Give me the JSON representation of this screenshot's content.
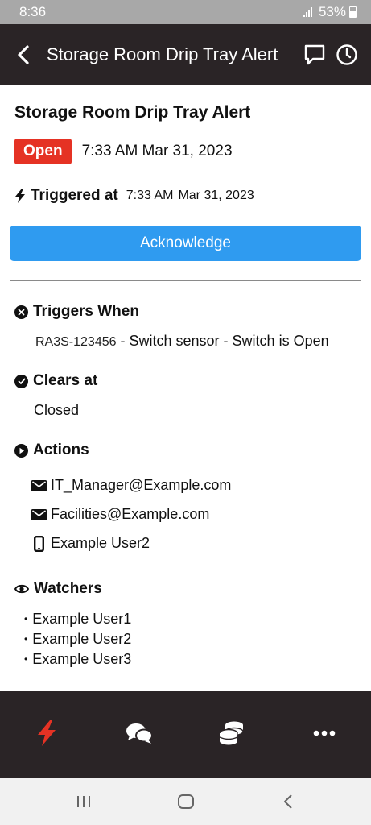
{
  "status_bar": {
    "time": "8:36",
    "battery": "53%"
  },
  "header": {
    "title": "Storage Room Drip Tray Alert",
    "back_icon": "chevron-left-icon",
    "comment_icon": "comment-icon",
    "history_icon": "clock-icon"
  },
  "alert": {
    "title": "Storage Room Drip Tray Alert",
    "status": "Open",
    "status_color": "#e53224",
    "status_time": "7:33 AM Mar 31, 2023",
    "triggered_label": "Triggered at",
    "triggered_time": "7:33 AM",
    "triggered_date": "Mar 31, 2023",
    "acknowledge_label": "Acknowledge",
    "accent_color": "#2f9bf0"
  },
  "triggers_when": {
    "label": "Triggers When",
    "sensor_id": "RA3S-123456",
    "description": " - Switch sensor - Switch is Open"
  },
  "clears_at": {
    "label": "Clears at",
    "value": "Closed"
  },
  "actions": {
    "label": "Actions",
    "items": [
      {
        "icon": "envelope-icon",
        "text": "IT_Manager@Example.com"
      },
      {
        "icon": "envelope-icon",
        "text": "Facilities@Example.com"
      },
      {
        "icon": "phone-icon",
        "text": "Example User2"
      }
    ]
  },
  "watchers": {
    "label": "Watchers",
    "items": [
      "Example User1",
      "Example User2",
      "Example User3"
    ]
  },
  "bottom_nav": [
    {
      "name": "alerts",
      "icon": "lightning-icon",
      "active": true,
      "color": "#e53224"
    },
    {
      "name": "messages",
      "icon": "chat-bubbles-icon",
      "active": false
    },
    {
      "name": "credits",
      "icon": "coins-icon",
      "active": false
    },
    {
      "name": "more",
      "icon": "ellipsis-icon",
      "active": false
    }
  ]
}
